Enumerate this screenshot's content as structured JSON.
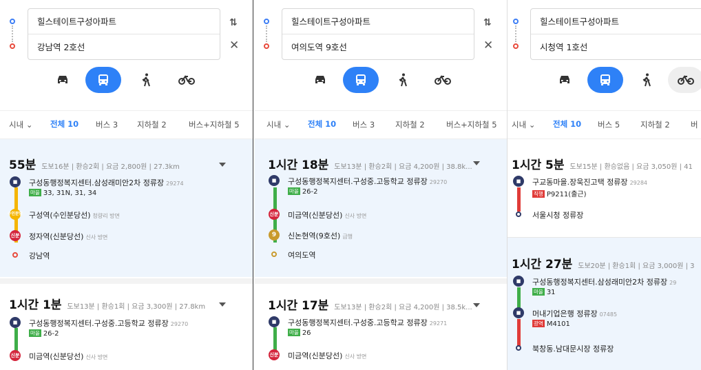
{
  "colors": {
    "accent": "#2e81f7",
    "bus": "#2f3a68",
    "shinbundang": "#d4243b",
    "line_yellow": "#f5b500",
    "line9": "#c99a2d",
    "badge_green": "#3fae49",
    "badge_red": "#e03b38"
  },
  "panels": [
    {
      "origin": "힐스테이트구성아파트",
      "destination": "강남역 2호선",
      "filters": {
        "city": "시내",
        "all": "전체 10",
        "bus": "버스 3",
        "subway": "지하철 2",
        "bus_subway": "버스+지하철 5"
      },
      "routes": [
        {
          "time": "55분",
          "meta": "도보16분 | 환승2회 | 요금 2,800원 | 27.3km",
          "stops": [
            {
              "name": "구성동행정복지센터.삼성래미안2차 정류장",
              "sub": "29274",
              "badge": "마을",
              "route": "33, 31N, 31, 34"
            },
            {
              "icon": "수인분당",
              "name": "구성역(수인분당선)",
              "sub": "청량리 방면"
            },
            {
              "icon": "신분",
              "name": "정자역(신분당선)",
              "sub": "신사 방면"
            },
            {
              "name": "강남역"
            }
          ]
        },
        {
          "time": "1시간 1분",
          "meta": "도보13분 | 환승1회 | 요금 3,300원 | 27.8km",
          "stops": [
            {
              "name": "구성동행정복지센터.구성중.고등학교 정류장",
              "sub": "29270",
              "badge": "마을",
              "route": "26-2"
            },
            {
              "icon": "신분",
              "name": "미금역(신분당선)",
              "sub": "신사 방면"
            }
          ]
        }
      ]
    },
    {
      "origin": "힐스테이트구성아파트",
      "destination": "여의도역 9호선",
      "filters": {
        "city": "시내",
        "all": "전체 10",
        "bus": "버스 3",
        "subway": "지하철 2",
        "bus_subway": "버스+지하철 5"
      },
      "routes": [
        {
          "time": "1시간 18분",
          "meta": "도보13분 | 환승2회 | 요금 4,200원 | 38.8k...",
          "stops": [
            {
              "name": "구성동행정복지센터.구성중.고등학교 정류장",
              "sub": "29270",
              "badge": "마을",
              "route": "26-2"
            },
            {
              "icon": "신분",
              "name": "미금역(신분당선)",
              "sub": "신사 방면"
            },
            {
              "icon": "9",
              "name": "신논현역(9호선)",
              "sub": "급행"
            },
            {
              "name": "여의도역"
            }
          ]
        },
        {
          "time": "1시간 17분",
          "meta": "도보13분 | 환승2회 | 요금 4,200원 | 38.5k...",
          "stops": [
            {
              "name": "구성동행정복지센터.구성중.고등학교 정류장",
              "sub": "29271",
              "badge": "마을",
              "route": "26"
            },
            {
              "icon": "신분",
              "name": "미금역(신분당선)",
              "sub": "신사 방면"
            }
          ]
        }
      ]
    },
    {
      "origin": "힐스테이트구성아파트",
      "destination": "시청역 1호선",
      "filters": {
        "city": "시내",
        "all": "전체 10",
        "bus": "버스 5",
        "subway": "지하철 2",
        "bus_subway": "버"
      },
      "routes": [
        {
          "time": "1시간 5분",
          "meta": "도보15분 | 환승없음 | 요금 3,050원 | 41",
          "stops": [
            {
              "name": "구교동마을.장욱진고택 정류장",
              "sub": "29284",
              "badge": "직행",
              "route": "P9211(출근)"
            },
            {
              "name": "서울시청 정류장"
            }
          ]
        },
        {
          "time": "1시간 27분",
          "meta": "도보20분 | 환승1회 | 요금 3,000원 | 3",
          "stops": [
            {
              "name": "구성동행정복지센터.삼성래미안2차 정류장",
              "sub": "29",
              "badge": "마을",
              "route": "31"
            },
            {
              "name": "머내기업은행 정류장",
              "sub": "07485",
              "badge": "광역",
              "route": "M4101"
            },
            {
              "name": "북창동.남대문시장 정류장"
            }
          ]
        }
      ]
    }
  ]
}
